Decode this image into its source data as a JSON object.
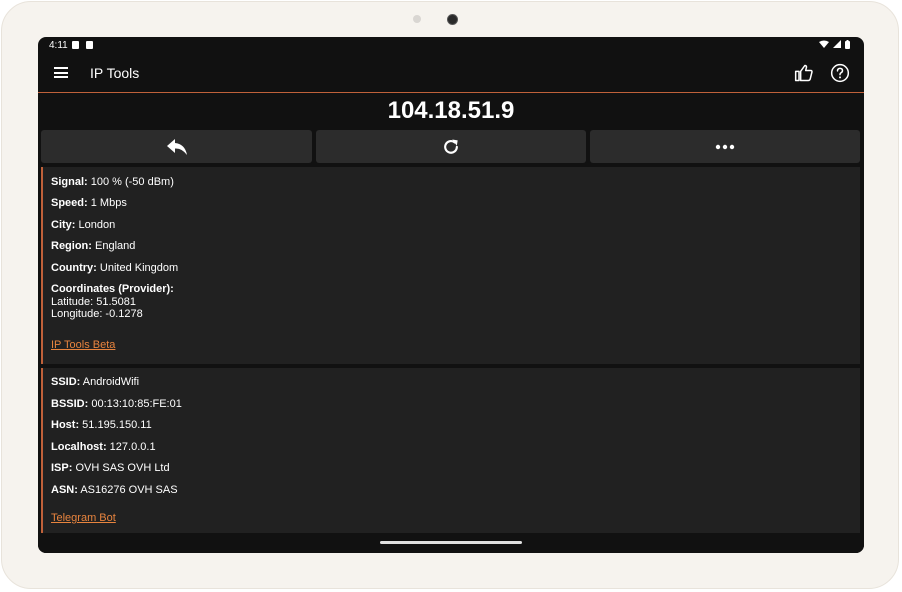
{
  "status_bar": {
    "time": "4:11",
    "icons": [
      "notification-icon",
      "sd-card-icon",
      "wifi-icon",
      "cellular-icon",
      "battery-icon"
    ]
  },
  "toolbar": {
    "title": "IP Tools",
    "menu_icon": "menu-icon",
    "like_icon": "thumb-up-icon",
    "help_icon": "help-icon"
  },
  "ip_address": "104.18.51.9",
  "actions": [
    {
      "icon": "reply-icon"
    },
    {
      "icon": "refresh-icon"
    },
    {
      "icon": "more-icon"
    }
  ],
  "card1": {
    "signal_label": "Signal:",
    "signal_value": " 100 % (-50 dBm)",
    "speed_label": "Speed:",
    "speed_value": " 1 Mbps",
    "city_label": "City:",
    "city_value": " London",
    "region_label": "Region:",
    "region_value": " England",
    "country_label": "Country:",
    "country_value": " United Kingdom",
    "coords_label": "Coordinates (Provider):",
    "latitude": "Latitude: 51.5081",
    "longitude": "Longitude: -0.1278",
    "link": "IP Tools Beta"
  },
  "card2": {
    "ssid_label": "SSID:",
    "ssid_value": " AndroidWifi",
    "bssid_label": "BSSID:",
    "bssid_value": " 00:13:10:85:FE:01",
    "host_label": "Host:",
    "host_value": " 51.195.150.11",
    "localhost_label": "Localhost:",
    "localhost_value": " 127.0.0.1",
    "isp_label": "ISP:",
    "isp_value": " OVH SAS OVH Ltd",
    "asn_label": "ASN:",
    "asn_value": " AS16276 OVH SAS",
    "link": "Telegram Bot"
  },
  "colors": {
    "accent": "#c0613a",
    "link": "#e8843e",
    "background": "#111111",
    "card": "#212121",
    "button": "#2c2c2c"
  }
}
